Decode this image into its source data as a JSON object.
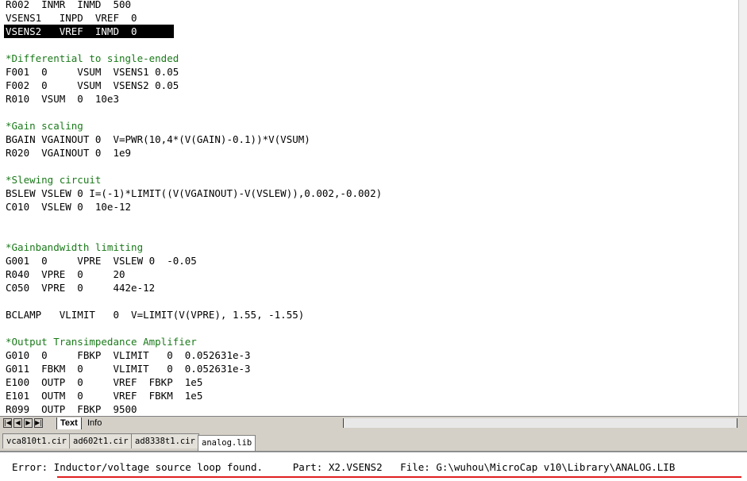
{
  "editor": {
    "lines": [
      "R002  INMR  INMD  500",
      "VSENS1   INPD  VREF  0",
      "VSENS2   VREF  INMD  0",
      "",
      "*Differential to single-ended",
      "F001  0     VSUM  VSENS1 0.05",
      "F002  0     VSUM  VSENS2 0.05",
      "R010  VSUM  0  10e3",
      "",
      "*Gain scaling",
      "BGAIN VGAINOUT 0  V=PWR(10,4*(V(GAIN)-0.1))*V(VSUM)",
      "R020  VGAINOUT 0  1e9",
      "",
      "*Slewing circuit",
      "BSLEW VSLEW 0 I=(-1)*LIMIT((V(VGAINOUT)-V(VSLEW)),0.002,-0.002)",
      "C010  VSLEW 0  10e-12",
      "",
      "",
      "*Gainbandwidth limiting",
      "G001  0     VPRE  VSLEW 0  -0.05",
      "R040  VPRE  0     20",
      "C050  VPRE  0     442e-12",
      "",
      "BCLAMP   VLIMIT   0  V=LIMIT(V(VPRE), 1.55, -1.55)",
      "",
      "*Output Transimpedance Amplifier",
      "G010  0     FBKP  VLIMIT   0  0.052631e-3",
      "G011  FBKM  0     VLIMIT   0  0.052631e-3",
      "E100  OUTP  0     VREF  FBKP  1e5",
      "E101  OUTM  0     VREF  FBKM  1e5",
      "R099  OUTP  FBKP  9500"
    ],
    "selected_line_index": 2,
    "comment_color": "#1a7a1a"
  },
  "view_tabs": {
    "text": "Text",
    "info": "Info"
  },
  "nav_icons": [
    "first-page-icon",
    "prev-page-icon",
    "next-page-icon",
    "last-page-icon"
  ],
  "file_tabs": [
    "vca810t1.cir",
    "ad602t1.cir",
    "ad8338t1.cir",
    "analog.lib"
  ],
  "active_file_tab": 3,
  "status": {
    "message": "Error: Inductor/voltage source loop found.     Part: X2.VSENS2   File: G:\\wuhou\\MicroCap v10\\Library\\ANALOG.LIB"
  }
}
